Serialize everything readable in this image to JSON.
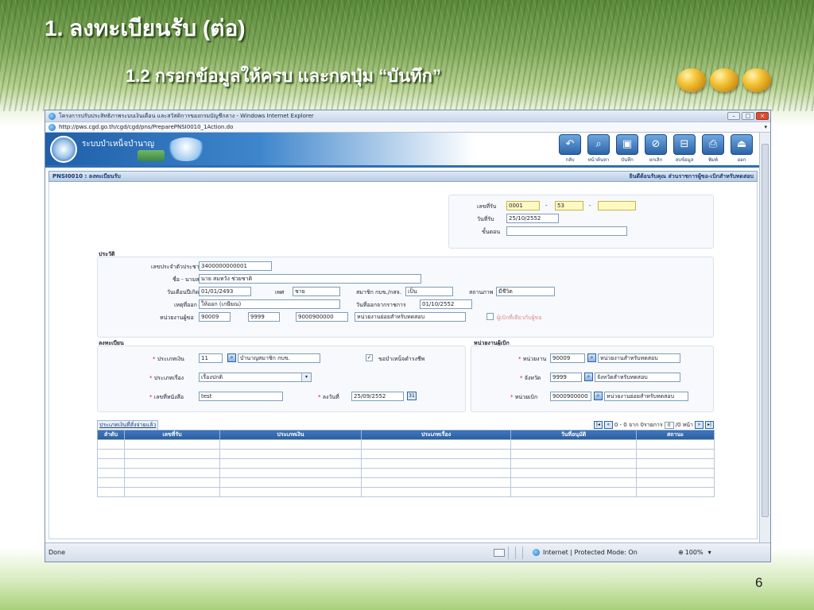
{
  "slide": {
    "title": "1. ลงทะเบียนรับ (ต่อ)",
    "subtitle": "1.2 กรอกข้อมูลให้ครบ และกดปุ่ม “บันทึก”",
    "page_number": "6"
  },
  "browser": {
    "window_title": "โครงการปรับประสิทธิภาพระบบเงินเดือน และสวัสดิการของกรมบัญชีกลาง - Windows Internet Explorer",
    "url": "http://pws.cgd.go.th/cgd/cgd/pns/PreparePNSI0010_1Action.do",
    "status_left": "Done",
    "status_zone": "Internet | Protected Mode: On",
    "zoom": "100%"
  },
  "app": {
    "name": "ระบบบำเหน็จบำนาญ",
    "toolbar": [
      {
        "icon": "↶",
        "label": "กลับ",
        "name": "back"
      },
      {
        "icon": "⌕",
        "label": "หน้าค้นหา",
        "name": "search-page"
      },
      {
        "icon": "▣",
        "label": "บันทึก",
        "name": "save"
      },
      {
        "icon": "⊘",
        "label": "ยกเลิก",
        "name": "cancel"
      },
      {
        "icon": "⊟",
        "label": "ลบข้อมูล",
        "name": "delete"
      },
      {
        "icon": "⎙",
        "label": "พิมพ์",
        "name": "print"
      },
      {
        "icon": "⏏",
        "label": "ออก",
        "name": "exit"
      }
    ],
    "screen_title": "PNSI0010 : ลงทะเบียนรับ",
    "welcome": "ยินดีต้อนรับคุณ ส่วนราชการผู้ขอ-เบิกสำหรับทดสอบ"
  },
  "receipt": {
    "no_label": "เลขที่รับ",
    "no_part1": "0001",
    "no_sep": "-",
    "no_part2": "53",
    "no_part3": "",
    "date_label": "วันที่รับ",
    "date": "25/10/2552",
    "step_label": "ขั้นตอน",
    "step": ""
  },
  "history": {
    "section": "ประวัติ",
    "id_label": "เลขประจำตัวประชาชน",
    "id": "3400000000001",
    "name_label": "ชื่อ - นามสกุล",
    "name": "นาย สมหวัง ช่วยชาติ",
    "birth_label": "วันเดือนปีเกิด",
    "birth": "01/01/2493",
    "sex_label": "เพศ",
    "sex": "ชาย",
    "member_label": "สมาชิก กบข./กสจ.",
    "member": "เป็น",
    "status_label": "สถานภาพ",
    "status": "มีชีวิต",
    "reason_label": "เหตุที่ออก",
    "reason": "ให้ออก (เกษียณ)",
    "leave_label": "วันที่ออกจากราชการ",
    "leave": "01/10/2552",
    "unit_label": "หน่วยงานผู้ขอ",
    "unit1": "90009",
    "unit2": "9999",
    "unit3": "9000900000",
    "unit_name": "หน่วยงานย่อยสำหรับทดสอบ",
    "same_label": "ผู้เบิกที่เดียวกับผู้ขอ"
  },
  "register": {
    "section": "ลงทะเบียน",
    "money_label": "ประเภทเงิน",
    "money_code": "11",
    "money_name": "บำนาญสมาชิก กบข.",
    "lifetime_label": "ขอบำเหน็จดำรงชีพ",
    "subject_label": "ประเภทเรื่อง",
    "subject": "เรื่องปกติ",
    "doc_label": "เลขที่หนังสือ",
    "doc": "test",
    "date_label": "ลงวันที่",
    "date": "25/09/2552",
    "cal_icon": "31"
  },
  "payer": {
    "section": "หน่วยงานผู้เบิก",
    "agency_label": "หน่วยงาน",
    "agency_code": "90009",
    "agency_name": "หน่วยงานสำหรับทดสอบ",
    "province_label": "จังหวัด",
    "province_code": "9999",
    "province_name": "จังหวัดสำหรับทดสอบ",
    "unit_label": "หน่วยเบิก",
    "unit_code": "9000900000",
    "unit_name": "หน่วยงานย่อยสำหรับทดสอบ"
  },
  "grid": {
    "caption": "ประเภทเงินที่สั่งจ่ายแล้ว",
    "pager_prefix": "0 - 0 จาก 0รายการ",
    "page": "0",
    "pager_suffix": "/0 หน้า",
    "columns": [
      "ลำดับ",
      "เลขที่รับ",
      "ประเภทเงิน",
      "ประเภทเรื่อง",
      "วันที่อนุมัติ",
      "สถานะ"
    ],
    "rows": [
      [
        "",
        "",
        "",
        "",
        "",
        ""
      ],
      [
        "",
        "",
        "",
        "",
        "",
        ""
      ],
      [
        "",
        "",
        "",
        "",
        "",
        ""
      ],
      [
        "",
        "",
        "",
        "",
        "",
        ""
      ],
      [
        "",
        "",
        "",
        "",
        "",
        ""
      ],
      [
        "",
        "",
        "",
        "",
        "",
        ""
      ]
    ]
  },
  "colors": {
    "accent": "#2b5d9c",
    "required": "#e2201f",
    "highlight_input": "#fff9c2"
  }
}
